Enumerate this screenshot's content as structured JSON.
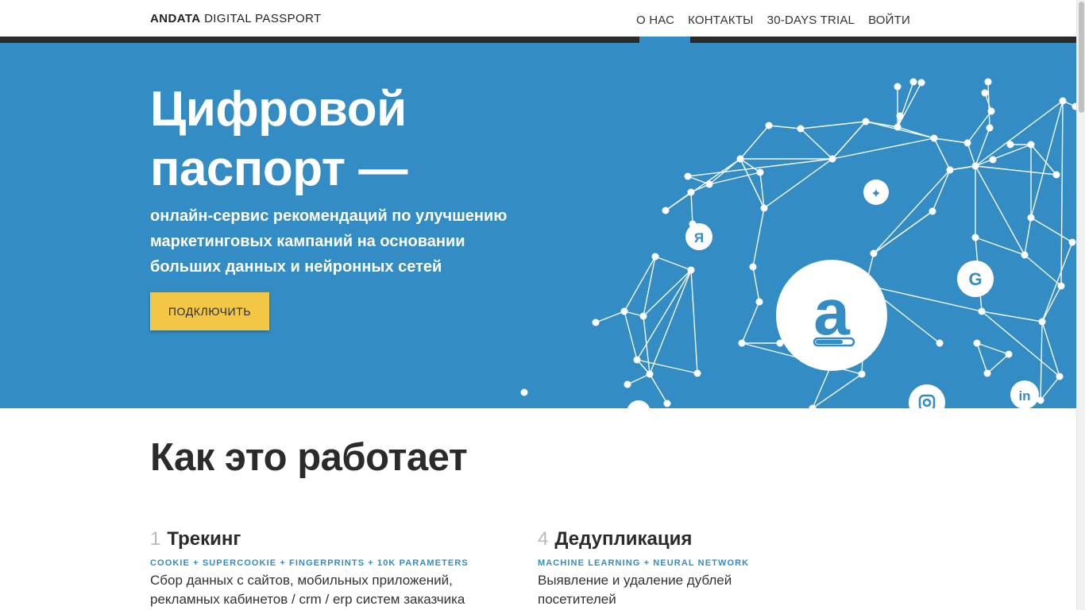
{
  "header": {
    "brand_bold": "ANDATA",
    "brand_rest": "DIGITAL PASSPORT",
    "nav": [
      "О НАС",
      "КОНТАКТЫ",
      "30-DAYS TRIAL",
      "ВОЙТИ"
    ],
    "active_nav": "О НАС"
  },
  "hero": {
    "title_lines": [
      "Цифровой",
      "паспорт —"
    ],
    "subtitle_lines": [
      "онлайн-сервис рекомендаций по улучшению",
      "маркетинговых кампаний на основании",
      "больших данных и нейронных сетей"
    ],
    "cta_label": "ПОДКЛЮЧИТЬ",
    "network_icons": [
      "andata-logo-icon",
      "twitter-icon",
      "yandex-icon",
      "google-icon",
      "instagram-icon",
      "linkedin-icon"
    ]
  },
  "how": {
    "title": "Как это работает",
    "steps": [
      {
        "num": "1",
        "name": "Трекинг",
        "tags": "COOKIE + SUPERCOOKIE + FINGERPRINTS + 10K PARAMETERS",
        "desc_lines": [
          "Сбор данных с сайтов, мобильных приложений,",
          "рекламных кабинетов / crm / erp систем заказчика"
        ]
      },
      {
        "num": "4",
        "name": "Дедупликация",
        "tags": "MACHINE LEARNING + NEURAL NETWORK",
        "desc_lines": [
          "Выявление и удаление дублей",
          "посетителей"
        ]
      }
    ]
  },
  "colors": {
    "hero_bg": "#338cc4",
    "accent": "#338cc4",
    "cta": "#f2c744",
    "dark_strip": "#2b2b2b"
  }
}
